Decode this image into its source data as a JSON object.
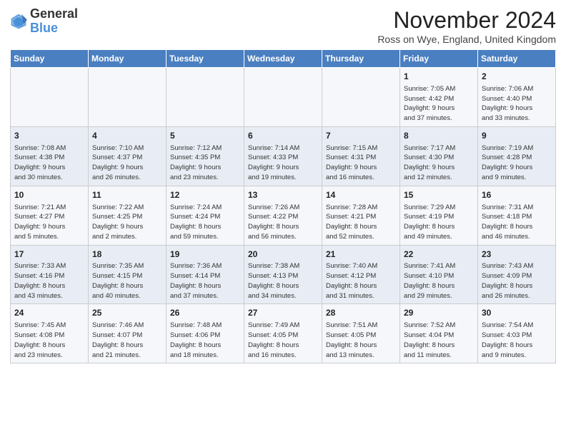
{
  "header": {
    "title": "November 2024",
    "location": "Ross on Wye, England, United Kingdom",
    "logo_general": "General",
    "logo_blue": "Blue"
  },
  "days_of_week": [
    "Sunday",
    "Monday",
    "Tuesday",
    "Wednesday",
    "Thursday",
    "Friday",
    "Saturday"
  ],
  "weeks": [
    [
      {
        "day": "",
        "info": ""
      },
      {
        "day": "",
        "info": ""
      },
      {
        "day": "",
        "info": ""
      },
      {
        "day": "",
        "info": ""
      },
      {
        "day": "",
        "info": ""
      },
      {
        "day": "1",
        "info": "Sunrise: 7:05 AM\nSunset: 4:42 PM\nDaylight: 9 hours\nand 37 minutes."
      },
      {
        "day": "2",
        "info": "Sunrise: 7:06 AM\nSunset: 4:40 PM\nDaylight: 9 hours\nand 33 minutes."
      }
    ],
    [
      {
        "day": "3",
        "info": "Sunrise: 7:08 AM\nSunset: 4:38 PM\nDaylight: 9 hours\nand 30 minutes."
      },
      {
        "day": "4",
        "info": "Sunrise: 7:10 AM\nSunset: 4:37 PM\nDaylight: 9 hours\nand 26 minutes."
      },
      {
        "day": "5",
        "info": "Sunrise: 7:12 AM\nSunset: 4:35 PM\nDaylight: 9 hours\nand 23 minutes."
      },
      {
        "day": "6",
        "info": "Sunrise: 7:14 AM\nSunset: 4:33 PM\nDaylight: 9 hours\nand 19 minutes."
      },
      {
        "day": "7",
        "info": "Sunrise: 7:15 AM\nSunset: 4:31 PM\nDaylight: 9 hours\nand 16 minutes."
      },
      {
        "day": "8",
        "info": "Sunrise: 7:17 AM\nSunset: 4:30 PM\nDaylight: 9 hours\nand 12 minutes."
      },
      {
        "day": "9",
        "info": "Sunrise: 7:19 AM\nSunset: 4:28 PM\nDaylight: 9 hours\nand 9 minutes."
      }
    ],
    [
      {
        "day": "10",
        "info": "Sunrise: 7:21 AM\nSunset: 4:27 PM\nDaylight: 9 hours\nand 5 minutes."
      },
      {
        "day": "11",
        "info": "Sunrise: 7:22 AM\nSunset: 4:25 PM\nDaylight: 9 hours\nand 2 minutes."
      },
      {
        "day": "12",
        "info": "Sunrise: 7:24 AM\nSunset: 4:24 PM\nDaylight: 8 hours\nand 59 minutes."
      },
      {
        "day": "13",
        "info": "Sunrise: 7:26 AM\nSunset: 4:22 PM\nDaylight: 8 hours\nand 56 minutes."
      },
      {
        "day": "14",
        "info": "Sunrise: 7:28 AM\nSunset: 4:21 PM\nDaylight: 8 hours\nand 52 minutes."
      },
      {
        "day": "15",
        "info": "Sunrise: 7:29 AM\nSunset: 4:19 PM\nDaylight: 8 hours\nand 49 minutes."
      },
      {
        "day": "16",
        "info": "Sunrise: 7:31 AM\nSunset: 4:18 PM\nDaylight: 8 hours\nand 46 minutes."
      }
    ],
    [
      {
        "day": "17",
        "info": "Sunrise: 7:33 AM\nSunset: 4:16 PM\nDaylight: 8 hours\nand 43 minutes."
      },
      {
        "day": "18",
        "info": "Sunrise: 7:35 AM\nSunset: 4:15 PM\nDaylight: 8 hours\nand 40 minutes."
      },
      {
        "day": "19",
        "info": "Sunrise: 7:36 AM\nSunset: 4:14 PM\nDaylight: 8 hours\nand 37 minutes."
      },
      {
        "day": "20",
        "info": "Sunrise: 7:38 AM\nSunset: 4:13 PM\nDaylight: 8 hours\nand 34 minutes."
      },
      {
        "day": "21",
        "info": "Sunrise: 7:40 AM\nSunset: 4:12 PM\nDaylight: 8 hours\nand 31 minutes."
      },
      {
        "day": "22",
        "info": "Sunrise: 7:41 AM\nSunset: 4:10 PM\nDaylight: 8 hours\nand 29 minutes."
      },
      {
        "day": "23",
        "info": "Sunrise: 7:43 AM\nSunset: 4:09 PM\nDaylight: 8 hours\nand 26 minutes."
      }
    ],
    [
      {
        "day": "24",
        "info": "Sunrise: 7:45 AM\nSunset: 4:08 PM\nDaylight: 8 hours\nand 23 minutes."
      },
      {
        "day": "25",
        "info": "Sunrise: 7:46 AM\nSunset: 4:07 PM\nDaylight: 8 hours\nand 21 minutes."
      },
      {
        "day": "26",
        "info": "Sunrise: 7:48 AM\nSunset: 4:06 PM\nDaylight: 8 hours\nand 18 minutes."
      },
      {
        "day": "27",
        "info": "Sunrise: 7:49 AM\nSunset: 4:05 PM\nDaylight: 8 hours\nand 16 minutes."
      },
      {
        "day": "28",
        "info": "Sunrise: 7:51 AM\nSunset: 4:05 PM\nDaylight: 8 hours\nand 13 minutes."
      },
      {
        "day": "29",
        "info": "Sunrise: 7:52 AM\nSunset: 4:04 PM\nDaylight: 8 hours\nand 11 minutes."
      },
      {
        "day": "30",
        "info": "Sunrise: 7:54 AM\nSunset: 4:03 PM\nDaylight: 8 hours\nand 9 minutes."
      }
    ]
  ]
}
